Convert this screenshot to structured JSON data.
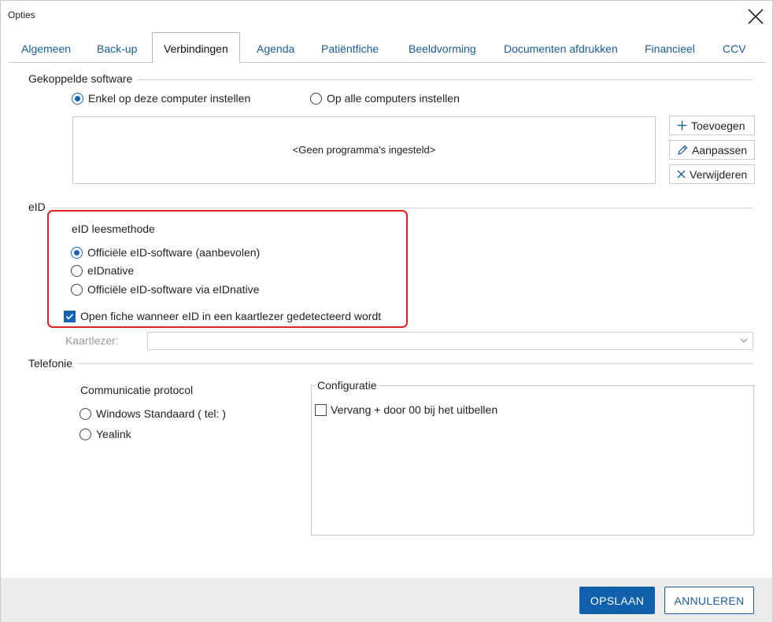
{
  "window": {
    "title": "Opties"
  },
  "tabs": [
    {
      "label": "Algemeen"
    },
    {
      "label": "Back-up"
    },
    {
      "label": "Verbindingen"
    },
    {
      "label": "Agenda"
    },
    {
      "label": "Patiëntfiche"
    },
    {
      "label": "Beeldvorming"
    },
    {
      "label": "Documenten afdrukken"
    },
    {
      "label": "Financieel"
    },
    {
      "label": "CCV"
    }
  ],
  "active_tab": "Verbindingen",
  "linked_software": {
    "section_label": "Gekoppelde software",
    "options": [
      {
        "label": "Enkel op deze computer instellen",
        "checked": true
      },
      {
        "label": "Op alle computers instellen",
        "checked": false
      }
    ],
    "empty_text": "<Geen programma's ingesteld>",
    "buttons": {
      "add": "Toevoegen",
      "edit": "Aanpassen",
      "remove": "Verwijderen"
    }
  },
  "eid": {
    "section_label": "eID",
    "method_label": "eID leesmethode",
    "options": [
      {
        "label": "Officiële eID-software (aanbevolen)",
        "checked": true
      },
      {
        "label": "eIDnative",
        "checked": false
      },
      {
        "label": "Officiële eID-software via eIDnative",
        "checked": false
      }
    ],
    "open_fiche_checkbox": {
      "label": "Open fiche wanneer eID in een kaartlezer gedetecteerd wordt",
      "checked": true
    },
    "card_reader_label": "Kaartlezer:",
    "card_reader_value": ""
  },
  "telephony": {
    "section_label": "Telefonie",
    "protocol_label": "Communicatie protocol",
    "options": [
      {
        "label": "Windows Standaard ( tel: )",
        "checked": false
      },
      {
        "label": "Yealink",
        "checked": false
      }
    ],
    "configuration": {
      "title": "Configuratie",
      "replace_checkbox": {
        "label": "Vervang + door 00 bij het uitbellen",
        "checked": false
      }
    }
  },
  "footer": {
    "save": "OPSLAAN",
    "cancel": "ANNULEREN"
  },
  "colors": {
    "accent": "#1060ab",
    "highlight_border": "#e02020"
  }
}
